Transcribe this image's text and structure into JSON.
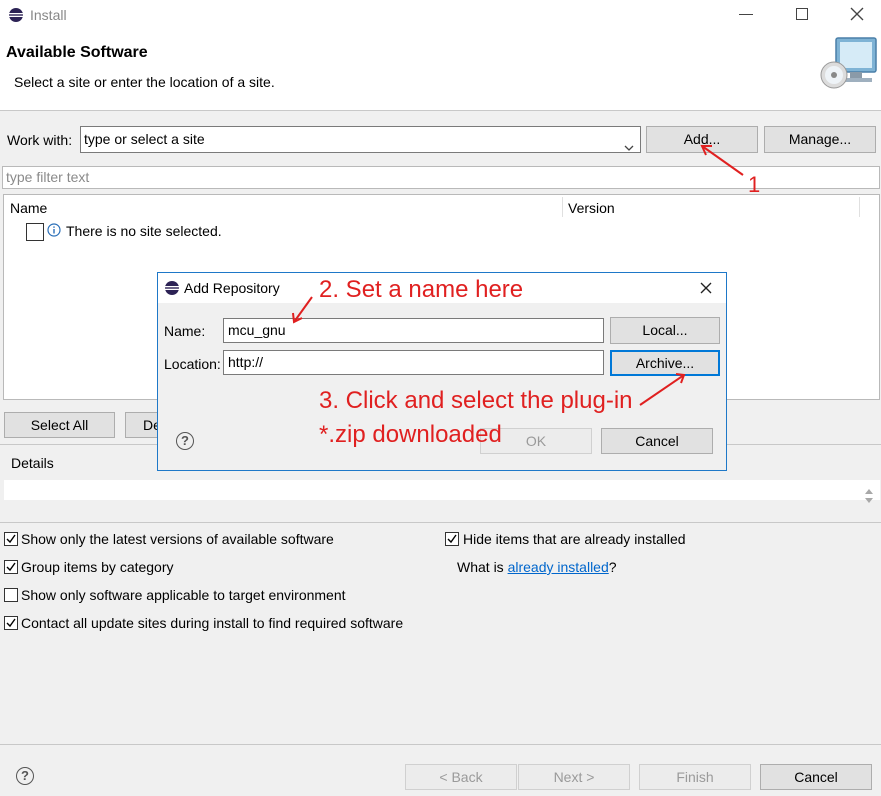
{
  "window": {
    "title": "Install",
    "header_title": "Available Software",
    "header_subtitle": "Select a site or enter the location of a site."
  },
  "work_with": {
    "label": "Work with:",
    "value": "type or select a site",
    "add_label": "Add...",
    "manage_label": "Manage..."
  },
  "filter": {
    "placeholder": "type filter text"
  },
  "table": {
    "columns": [
      "Name",
      "Version"
    ],
    "empty_message": "There is no site selected."
  },
  "selection": {
    "select_all_label": "Select All",
    "deselect_partial": "De"
  },
  "details": {
    "label": "Details"
  },
  "options": {
    "latest_versions": {
      "label": "Show only the latest versions of available software",
      "checked": true
    },
    "group_by_category": {
      "label": "Group items by category",
      "checked": true
    },
    "target_env": {
      "label": "Show only software applicable to target environment",
      "checked": false
    },
    "contact_sites": {
      "label": "Contact all update sites during install to find required software",
      "checked": true
    },
    "hide_installed": {
      "label": "Hide items that are already installed",
      "checked": true
    },
    "what_is_prefix": "What is ",
    "already_installed_link": "already installed",
    "what_is_suffix": "?"
  },
  "footer": {
    "back_label": "< Back",
    "next_label": "Next >",
    "finish_label": "Finish",
    "cancel_label": "Cancel"
  },
  "dialog": {
    "title": "Add Repository",
    "name_label": "Name:",
    "name_value": "mcu_gnu",
    "location_label": "Location:",
    "location_value": "http://",
    "local_label": "Local...",
    "archive_label": "Archive...",
    "ok_label": "OK",
    "cancel_label": "Cancel"
  },
  "annotations": {
    "step1": "1",
    "step2": "2. Set a name here",
    "step3_line1": "3. Click and select the plug-in",
    "step3_line2": "*.zip downloaded",
    "color": "#e02020"
  }
}
